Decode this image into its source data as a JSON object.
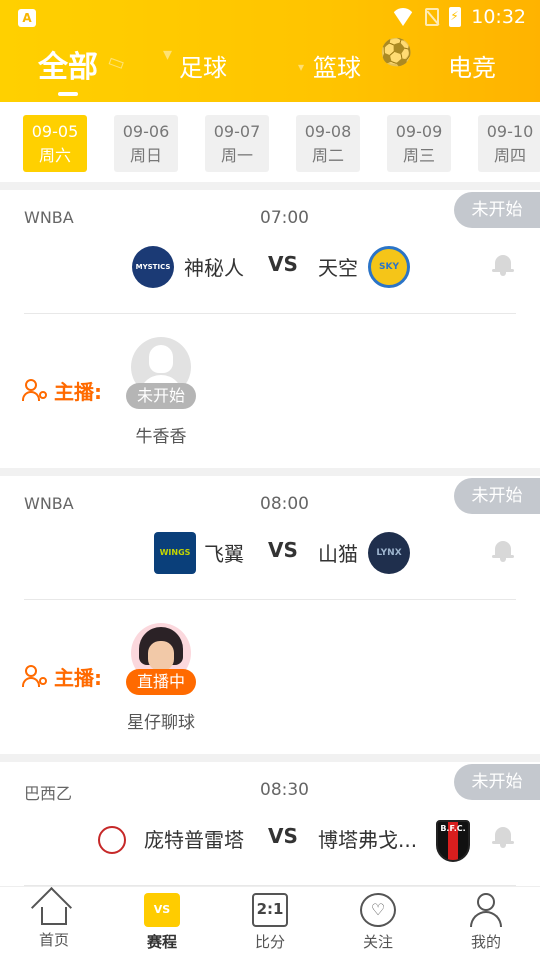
{
  "status_bar": {
    "time": "10:32",
    "app_icon": "A"
  },
  "category_tabs": [
    {
      "label": "全部",
      "active": true
    },
    {
      "label": "足球",
      "active": false
    },
    {
      "label": "篮球",
      "active": false
    },
    {
      "label": "电竞",
      "active": false
    }
  ],
  "dates": [
    {
      "date": "09-05",
      "weekday": "周六",
      "active": true
    },
    {
      "date": "09-06",
      "weekday": "周日",
      "active": false
    },
    {
      "date": "09-07",
      "weekday": "周一",
      "active": false
    },
    {
      "date": "09-08",
      "weekday": "周二",
      "active": false
    },
    {
      "date": "09-09",
      "weekday": "周三",
      "active": false
    },
    {
      "date": "09-10",
      "weekday": "周四",
      "active": false
    }
  ],
  "matches": [
    {
      "league": "WNBA",
      "time": "07:00",
      "status": "未开始",
      "home": {
        "name": "神秘人",
        "logo_text": "MYSTICS"
      },
      "away": {
        "name": "天空",
        "logo_text": "SKY"
      },
      "vs": "VS",
      "anchor_label": "主播:",
      "anchor": {
        "name": "牛香香",
        "state": "未开始",
        "live": false
      }
    },
    {
      "league": "WNBA",
      "time": "08:00",
      "status": "未开始",
      "home": {
        "name": "飞翼",
        "logo_text": "WINGS"
      },
      "away": {
        "name": "山猫",
        "logo_text": "LYNX"
      },
      "vs": "VS",
      "anchor_label": "主播:",
      "anchor": {
        "name": "星仔聊球",
        "state": "直播中",
        "live": true
      }
    },
    {
      "league": "巴西乙",
      "time": "08:30",
      "status": "未开始",
      "home": {
        "name": "庞特普雷塔",
        "logo_text": ""
      },
      "away": {
        "name": "博塔弗戈...",
        "logo_text": "B.F.C."
      },
      "vs": "VS"
    }
  ],
  "bottom_nav": [
    {
      "label": "首页",
      "icon": "home-icon"
    },
    {
      "label": "赛程",
      "icon": "schedule-icon",
      "icon_text": "VS",
      "active": true
    },
    {
      "label": "比分",
      "icon": "score-icon",
      "icon_text": "2:1"
    },
    {
      "label": "关注",
      "icon": "heart-icon",
      "icon_text": "♡"
    },
    {
      "label": "我的",
      "icon": "user-icon"
    }
  ],
  "colors": {
    "brand": "#ffc400",
    "live": "#ff6a00",
    "inactive_badge": "#c4c8ce"
  }
}
